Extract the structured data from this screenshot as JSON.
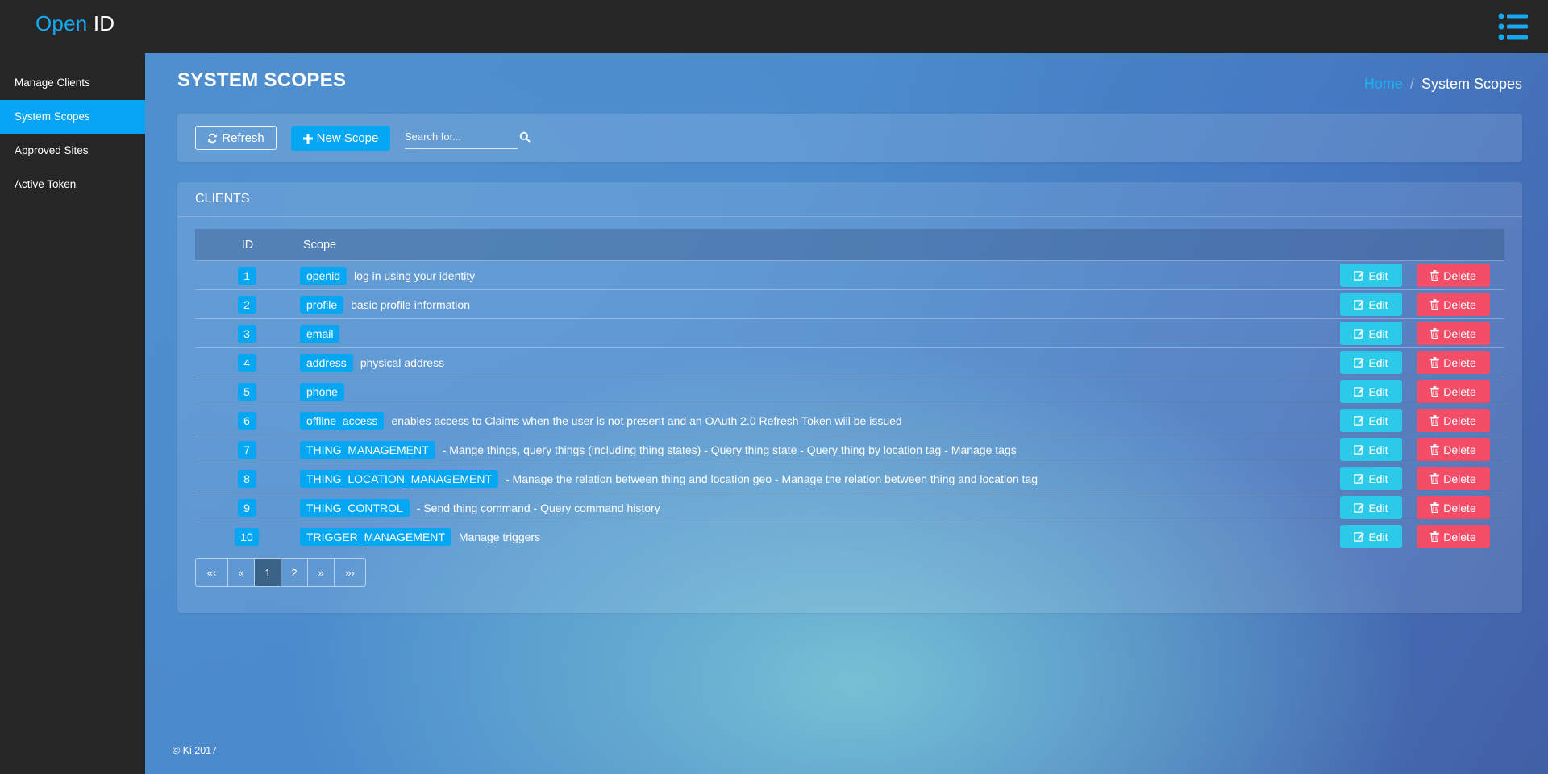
{
  "app": {
    "logo_part1": "Open",
    "logo_part2": "ID"
  },
  "sidebar": {
    "items": [
      {
        "label": "Manage Clients"
      },
      {
        "label": "System Scopes"
      },
      {
        "label": "Approved Sites"
      },
      {
        "label": "Active Token"
      }
    ],
    "active_index": 1
  },
  "header": {
    "title": "SYSTEM SCOPES",
    "breadcrumb": {
      "home": "Home",
      "separator": "/",
      "current": "System Scopes"
    }
  },
  "toolbar": {
    "refresh_label": "Refresh",
    "new_scope_label": "New Scope",
    "search_placeholder": "Search for..."
  },
  "panel": {
    "title": "CLIENTS"
  },
  "table": {
    "columns": {
      "id": "ID",
      "scope": "Scope"
    },
    "edit_label": "Edit",
    "delete_label": "Delete",
    "rows": [
      {
        "id": "1",
        "scope": "openid",
        "description": "log in using your identity"
      },
      {
        "id": "2",
        "scope": "profile",
        "description": "basic profile information"
      },
      {
        "id": "3",
        "scope": "email",
        "description": ""
      },
      {
        "id": "4",
        "scope": "address",
        "description": "physical address"
      },
      {
        "id": "5",
        "scope": "phone",
        "description": ""
      },
      {
        "id": "6",
        "scope": "offline_access",
        "description": "enables access to Claims when the user is not present and an OAuth 2.0 Refresh Token will be issued"
      },
      {
        "id": "7",
        "scope": "THING_MANAGEMENT",
        "description": "- Mange things, query things (including thing states) - Query thing state - Query thing by location tag - Manage tags"
      },
      {
        "id": "8",
        "scope": "THING_LOCATION_MANAGEMENT",
        "description": "- Manage the relation between thing and location geo - Manage the relation between thing and location tag"
      },
      {
        "id": "9",
        "scope": "THING_CONTROL",
        "description": "- Send thing command - Query command history"
      },
      {
        "id": "10",
        "scope": "TRIGGER_MANAGEMENT",
        "description": "Manage triggers"
      }
    ]
  },
  "pagination": {
    "first": "«‹",
    "prev": "«",
    "pages": [
      "1",
      "2"
    ],
    "active_page": "1",
    "next": "»",
    "last": "»›"
  },
  "footer": {
    "text": "© Ki 2017"
  },
  "colors": {
    "accent": "#05a7f5",
    "edit": "#2ccae8",
    "delete": "#f34d67",
    "chrome": "#262626"
  }
}
